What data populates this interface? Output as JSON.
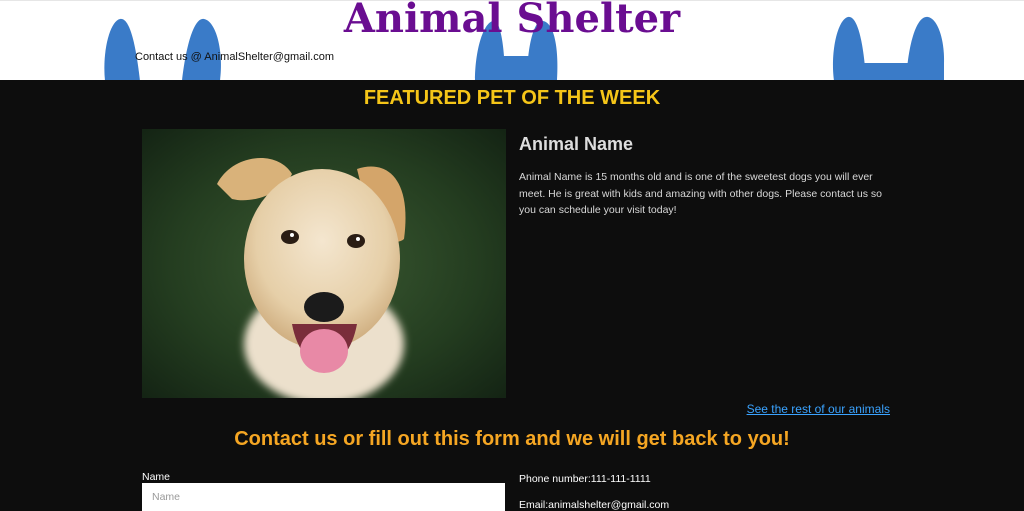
{
  "header": {
    "title": "Animal Shelter",
    "contact": "Contact us @ AnimalShelter@gmail.com"
  },
  "featured": {
    "heading": "FEATURED PET OF THE WEEK",
    "pet_name": "Animal Name",
    "description": "Animal Name is 15 months old and is one of the sweetest dogs you will ever meet. He is great with kids and amazing with other dogs. Please contact us so you can schedule your visit today!",
    "see_more_link": "See the rest of our animals"
  },
  "contact": {
    "heading": "Contact us or fill out this form and we will get back to you!",
    "name_label": "Name",
    "name_placeholder": "Name",
    "phone": "Phone number:111-111-1111",
    "email": "Email:animalshelter@gmail.com"
  },
  "colors": {
    "title": "#6a0d91",
    "featured_heading": "#f5c518",
    "contact_heading": "#f5a623",
    "link": "#3aa3ff",
    "ears": "#3a7bc8",
    "background": "#0d0d0d"
  }
}
